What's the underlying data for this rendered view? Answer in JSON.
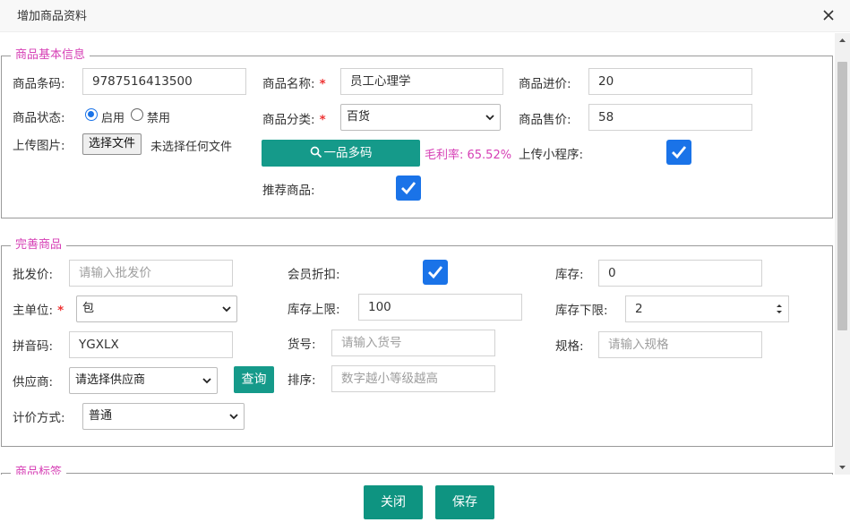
{
  "dialog": {
    "title": "增加商品资料"
  },
  "basic": {
    "legend": "商品基本信息",
    "barcode_label": "商品条码:",
    "barcode_value": "9787516413500",
    "name_label": "商品名称:",
    "name_value": "员工心理学",
    "cost_label": "商品进价:",
    "cost_value": "20",
    "status_label": "商品状态:",
    "status_enabled": "启用",
    "status_disabled": "禁用",
    "category_label": "商品分类:",
    "category_value": "百货",
    "price_label": "商品售价:",
    "price_value": "58",
    "upload_label": "上传图片:",
    "choose_file": "选择文件",
    "no_file": "未选择任何文件",
    "multi_code_btn": "一品多码",
    "margin_text": "毛利率: 65.52%",
    "upload_mini_label": "上传小程序:",
    "recommend_label": "推荐商品:",
    "required_mark": "*"
  },
  "more": {
    "legend": "完善商品",
    "wholesale_label": "批发价:",
    "wholesale_placeholder": "请输入批发价",
    "member_discount_label": "会员折扣:",
    "stock_label": "库存:",
    "stock_value": "0",
    "unit_label": "主单位:",
    "unit_value": "包",
    "stock_max_label": "库存上限:",
    "stock_max_value": "100",
    "stock_min_label": "库存下限:",
    "stock_min_value": "2",
    "pinyin_label": "拼音码:",
    "pinyin_value": "YGXLX",
    "item_no_label": "货号:",
    "item_no_placeholder": "请输入货号",
    "spec_label": "规格:",
    "spec_placeholder": "请输入规格",
    "supplier_label": "供应商:",
    "supplier_value": "请选择供应商",
    "query_btn": "查询",
    "sort_label": "排序:",
    "sort_placeholder": "数字越小等级越高",
    "pricing_label": "计价方式:",
    "pricing_value": "普通",
    "required_mark": "*"
  },
  "tags": {
    "legend": "商品标签"
  },
  "footer": {
    "close_label": "关闭",
    "save_label": "保存"
  },
  "colors": {
    "accent": "#159a8a",
    "legend": "#d63fb5",
    "checkbox": "#1a73e8",
    "required": "#e33333"
  }
}
